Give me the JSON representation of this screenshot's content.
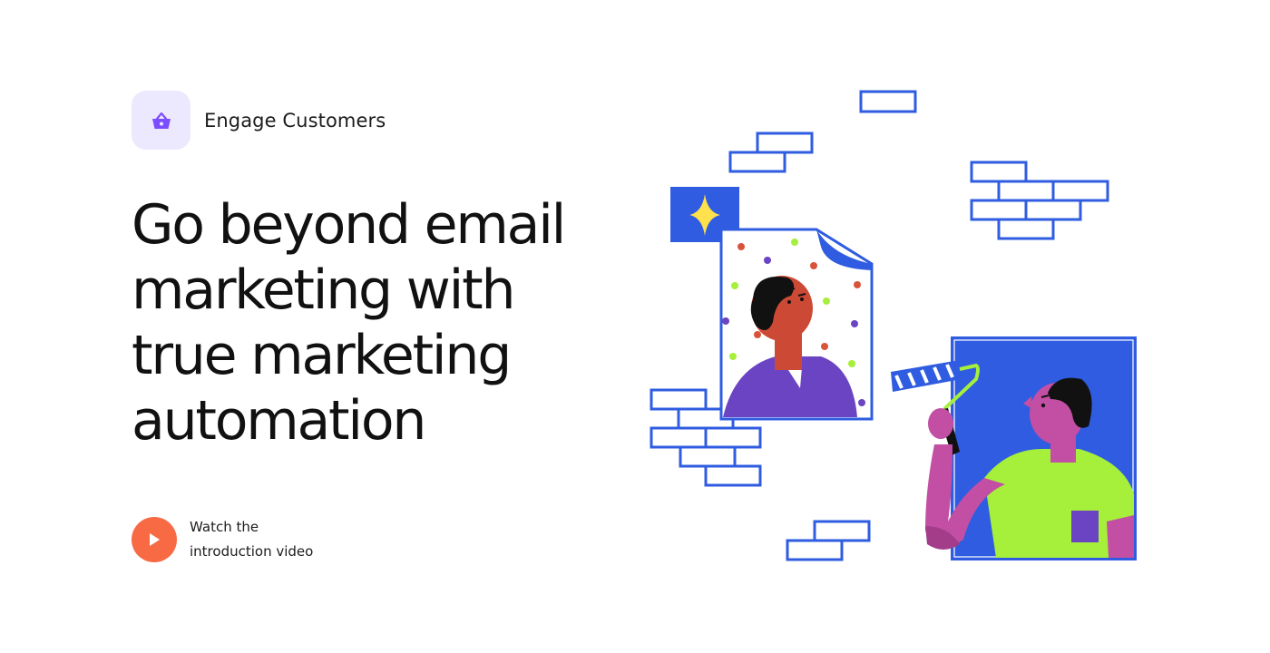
{
  "badge": {
    "icon": "basket-icon",
    "label": "Engage Customers"
  },
  "headline": {
    "lines": [
      "Go beyond email",
      "marketing with",
      "true marketing",
      "automation"
    ]
  },
  "video": {
    "icon": "play-icon",
    "line1": "Watch the",
    "line2": "introduction video"
  },
  "colors": {
    "accent_purple": "#7b4dff",
    "badge_bg": "#ece8fd",
    "play_orange": "#f76a44",
    "brick_blue": "#2f5ce0",
    "lime": "#a6ef3b",
    "magenta": "#c24fa3",
    "violet": "#6a44c2"
  }
}
